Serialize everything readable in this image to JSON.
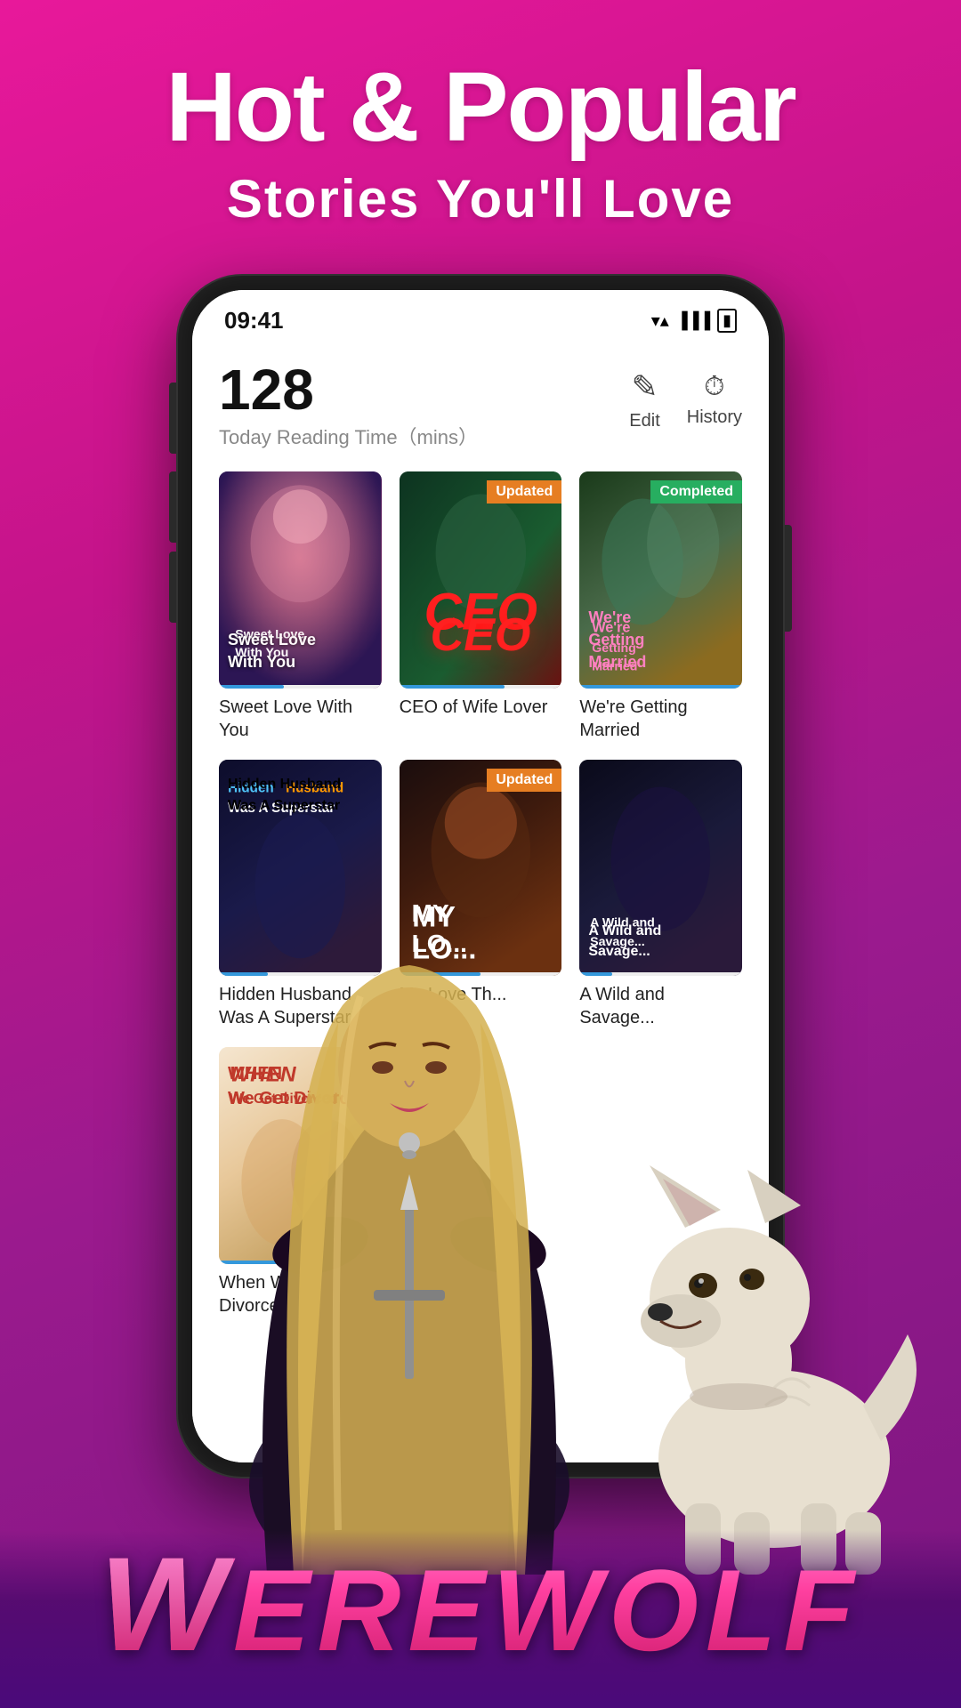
{
  "page": {
    "bg_gradient_start": "#e8189a",
    "bg_gradient_end": "#7a1680"
  },
  "headline": {
    "line1": "Hot & Popular",
    "line2": "Stories  You'll  Love"
  },
  "status_bar": {
    "time": "09:41",
    "wifi_icon": "▼",
    "signal_icon": "▲",
    "battery_icon": "▮"
  },
  "reading_stats": {
    "number": "128",
    "label": "Today Reading Time（mins）"
  },
  "actions": {
    "edit_label": "Edit",
    "history_label": "History",
    "edit_icon": "✏",
    "history_icon": "🕐"
  },
  "books": [
    {
      "id": "sweet-love",
      "title": "Sweet Love With You",
      "badge": "",
      "badge_type": "",
      "progress": 40,
      "cover_type": "sweet-love"
    },
    {
      "id": "ceo",
      "title": "CEO of Wife Lover",
      "badge": "Updated",
      "badge_type": "updated",
      "progress": 65,
      "cover_type": "ceo"
    },
    {
      "id": "married",
      "title": "We're Getting Married",
      "badge": "Completed",
      "badge_type": "completed",
      "progress": 100,
      "cover_type": "married"
    },
    {
      "id": "hidden",
      "title": "Hidden Husband Was A Superstar",
      "badge": "",
      "badge_type": "",
      "progress": 30,
      "cover_type": "hidden"
    },
    {
      "id": "mylove",
      "title": "My Love Th...",
      "badge": "Updated",
      "badge_type": "updated",
      "progress": 50,
      "cover_type": "mylove"
    },
    {
      "id": "wild",
      "title": "A Wild and Savage...",
      "badge": "",
      "badge_type": "",
      "progress": 20,
      "cover_type": "wild"
    },
    {
      "id": "when",
      "title": "When We Get Divorced",
      "badge": "",
      "badge_type": "",
      "progress": 55,
      "cover_type": "when"
    }
  ],
  "bottom_text": "Werewolf",
  "bottom_text_display": "WEREWOLF"
}
